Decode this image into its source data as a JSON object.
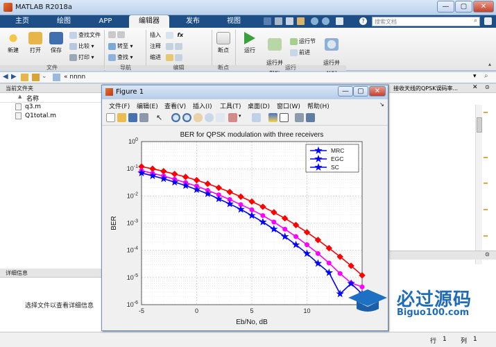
{
  "app": {
    "title": "MATLAB R2018a",
    "window_buttons": [
      "—",
      "▢",
      "✕"
    ]
  },
  "tabs": [
    {
      "label": "主页"
    },
    {
      "label": "绘图"
    },
    {
      "label": "APP"
    },
    {
      "label": "编辑器"
    },
    {
      "label": "发布"
    },
    {
      "label": "视图"
    }
  ],
  "search": {
    "placeholder": "搜索文档"
  },
  "toolstrip": {
    "file": {
      "new": "新建",
      "open": "打开",
      "save": "保存",
      "find_files": "查找文件",
      "compare": "比较",
      "print": "打印",
      "label": "文件"
    },
    "nav": {
      "insert": "插入",
      "fx": "fx",
      "goto": "转至",
      "comment": "注释",
      "find": "查找",
      "indent": "缩进",
      "label": "导航",
      "edit_label": "编辑"
    },
    "breakpoints": {
      "label": "断点",
      "btn": "断点"
    },
    "run": {
      "run": "运行",
      "run_advance": "运行并\n前进",
      "run_section": "运行节",
      "advance": "前进",
      "run_time": "运行并\n计时",
      "label": "运行"
    }
  },
  "address": {
    "path": "« nnnn"
  },
  "left_panel": {
    "title": "当前文件夹",
    "col_name": "名称",
    "col_sort": "▲",
    "files": [
      {
        "name": "q3.m"
      },
      {
        "name": "Q1total.m"
      }
    ],
    "details_title": "详细信息",
    "details_text": "选择文件以查看详细信息"
  },
  "editor_tab_text": "接收天线的QPSK误码率...",
  "status": {
    "row_label": "行",
    "row": "1",
    "col_label": "列",
    "col": "1"
  },
  "figure": {
    "title": "Figure 1",
    "menus": [
      "文件(F)",
      "编辑(E)",
      "查看(V)",
      "插入(I)",
      "工具(T)",
      "桌面(D)",
      "窗口(W)",
      "帮助(H)"
    ]
  },
  "watermark": {
    "text": "必过源码",
    "url": "Biguo100.com"
  },
  "chart_data": {
    "type": "line",
    "title": "BER for QPSK modulation with three receivers",
    "xlabel": "Eb/No, dB",
    "ylabel": "BER",
    "xlim": [
      -5,
      15
    ],
    "ylim_log10": [
      -6,
      0
    ],
    "yscale": "log",
    "grid": true,
    "legend_position": "top-right",
    "xticks": [
      "-5",
      "0",
      "5",
      "10"
    ],
    "yticks": [
      "10^0",
      "10^-1",
      "10^-2",
      "10^-3",
      "10^-4",
      "10^-5",
      "10^-6"
    ],
    "x": [
      -5,
      -4,
      -3,
      -2,
      -1,
      0,
      1,
      2,
      3,
      4,
      5,
      6,
      7,
      8,
      9,
      10,
      11,
      12,
      13,
      14,
      15
    ],
    "series": [
      {
        "name": "MRC",
        "color": "#0000ff",
        "marker": "star",
        "values": [
          0.07,
          0.055,
          0.043,
          0.032,
          0.024,
          0.017,
          0.012,
          0.0078,
          0.0051,
          0.0032,
          0.0019,
          0.0011,
          0.0006,
          0.00032,
          0.00016,
          7.6e-05,
          3.3e-05,
          1.5e-05,
          2.5e-06,
          6e-06,
          2.5e-06
        ]
      },
      {
        "name": "EGC",
        "color": "#ff00ff",
        "marker": "circle",
        "values": [
          0.085,
          0.068,
          0.054,
          0.041,
          0.031,
          0.023,
          0.016,
          0.011,
          0.0074,
          0.0048,
          0.0031,
          0.0019,
          0.0011,
          0.0006,
          0.00032,
          0.00016,
          7.6e-05,
          3.4e-05,
          1.4e-05,
          6.3e-06,
          4.5e-06
        ]
      },
      {
        "name": "SC",
        "color": "#ff0000",
        "marker": "diamond",
        "values": [
          0.12,
          0.1,
          0.081,
          0.064,
          0.05,
          0.038,
          0.028,
          0.02,
          0.014,
          0.0094,
          0.0062,
          0.004,
          0.0025,
          0.0015,
          0.00085,
          0.00046,
          0.00024,
          0.00012,
          5.8e-05,
          2.7e-05,
          1.2e-05
        ]
      }
    ]
  }
}
